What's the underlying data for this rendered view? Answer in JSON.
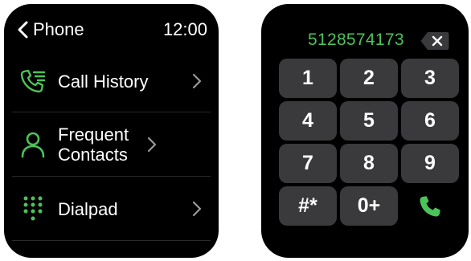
{
  "left_screen": {
    "header": {
      "title": "Phone",
      "time": "12:00"
    },
    "menu_items": [
      {
        "icon": "call-history-icon",
        "label": "Call History"
      },
      {
        "icon": "contact-person-icon",
        "label": "Frequent Contacts"
      },
      {
        "icon": "dialpad-icon",
        "label": "Dialpad"
      }
    ]
  },
  "right_screen": {
    "dialed_number": "5128574173",
    "delete_icon": "backspace-icon",
    "keys": [
      "1",
      "2",
      "3",
      "4",
      "5",
      "6",
      "7",
      "8",
      "9",
      "#*",
      "0+"
    ],
    "call_icon": "phone-call-icon"
  },
  "colors": {
    "accent_green": "#4cc35a",
    "key_background": "#3a3a3c",
    "screen_background": "#000000",
    "text": "#ffffff"
  }
}
